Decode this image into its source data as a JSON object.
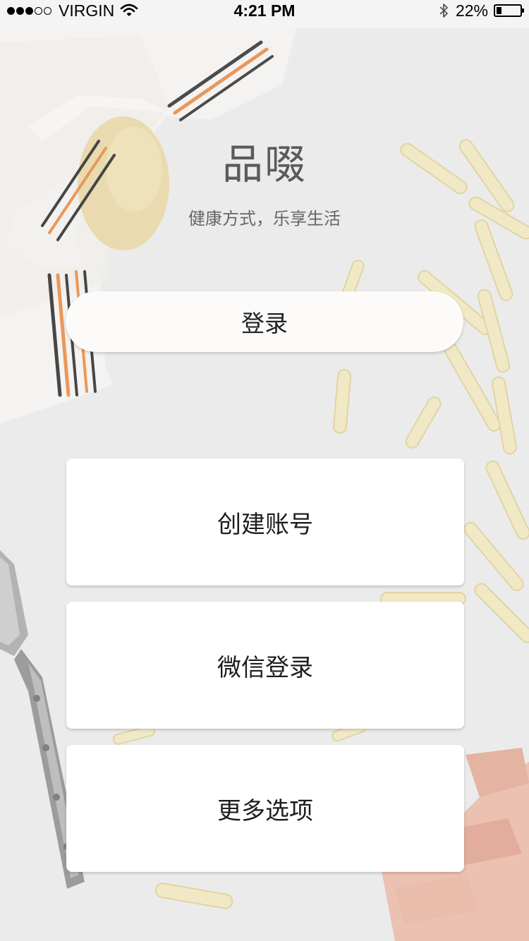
{
  "status_bar": {
    "signal_icon": "signal-dots-icon",
    "carrier": "VIRGIN",
    "wifi_icon": "wifi-icon",
    "time": "4:21 PM",
    "bluetooth_icon": "bluetooth-icon",
    "battery_percent": "22%",
    "battery_level": 0.22,
    "battery_icon": "battery-icon"
  },
  "header": {
    "title": "品啜",
    "slogan": "健康方式，乐享生活"
  },
  "actions": {
    "login_label": "登录",
    "create_account_label": "创建账号",
    "wechat_login_label": "微信登录",
    "more_options_label": "更多选项"
  }
}
